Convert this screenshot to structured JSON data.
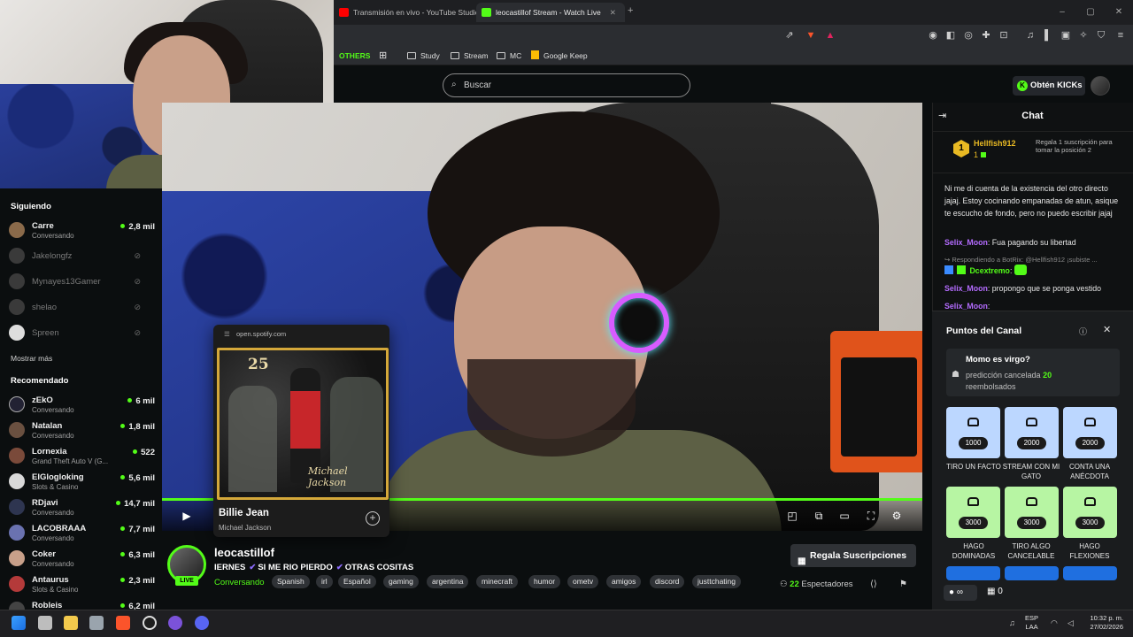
{
  "browser": {
    "tabs": [
      {
        "label": "Transmisión en vivo - YouTube Studio",
        "active": false
      },
      {
        "label": "leocastillof Stream - Watch Live",
        "active": true
      }
    ],
    "new_tab": "+",
    "bookmarks": {
      "others": "OTHERS",
      "items": [
        "Study",
        "Stream",
        "MC",
        "Google Keep"
      ]
    }
  },
  "header": {
    "search_placeholder": "Buscar",
    "kicks_button": "Obtén KICKs"
  },
  "sidebar": {
    "following_title": "Siguiendo",
    "following": [
      {
        "name": "Carre",
        "category": "Conversando",
        "viewers": "2,8 mil",
        "online": true
      },
      {
        "name": "Jakelongfz",
        "online": false
      },
      {
        "name": "Mynayes13Gamer",
        "online": false
      },
      {
        "name": "shelao",
        "online": false
      },
      {
        "name": "Spreen",
        "online": false
      }
    ],
    "show_more": "Mostrar más",
    "recommended_title": "Recomendado",
    "recommended": [
      {
        "name": "zEkO",
        "category": "Conversando",
        "viewers": "6 mil"
      },
      {
        "name": "Natalan",
        "category": "Conversando",
        "viewers": "1,8 mil"
      },
      {
        "name": "Lornexia",
        "category": "Grand Theft Auto V (G...",
        "viewers": "522"
      },
      {
        "name": "ElGlogloking",
        "category": "Slots & Casino",
        "viewers": "5,6 mil"
      },
      {
        "name": "RDjavi",
        "category": "Conversando",
        "viewers": "14,7 mil"
      },
      {
        "name": "LACOBRAAA",
        "category": "Conversando",
        "viewers": "7,7 mil"
      },
      {
        "name": "Coker",
        "category": "Conversando",
        "viewers": "6,3 mil"
      },
      {
        "name": "Antaurus",
        "category": "Slots & Casino",
        "viewers": "2,3 mil"
      },
      {
        "name": "Robleis",
        "category": "",
        "viewers": "6,2 mil"
      }
    ]
  },
  "spotify": {
    "url": "open.spotify.com",
    "album_number": "25",
    "album_signature": "Michael Jackson",
    "song": "Billie Jean",
    "artist": "Michael Jackson"
  },
  "channel": {
    "name": "leocastillof",
    "live_badge": "LIVE",
    "title_parts": [
      "IERNES",
      "SI ME RIO PIERDO",
      "OTRAS COSITAS"
    ],
    "category": "Conversando",
    "tags": [
      "Spanish",
      "irl",
      "Español",
      "gaming",
      "argentina",
      "minecraft",
      "humor",
      "ometv",
      "amigos",
      "discord",
      "justtchating"
    ],
    "gift_subs_button": "Regala Suscripciones",
    "viewers_count": "22",
    "viewers_label": "Espectadores"
  },
  "chat": {
    "title": "Chat",
    "pinned": {
      "badge": "1",
      "user": "Hellfish912",
      "count": "1",
      "gift_text": "Regala 1 suscripción para tomar la posición 2"
    },
    "messages": [
      {
        "user": "",
        "text": "Ni me di cuenta de la existencia del otro directo jajaj. Estoy cocinando empanadas de atun, asique te escucho de fondo, pero no puedo escribir jajaj",
        "color": "#e6e6e6"
      },
      {
        "user": "Selix_Moon",
        "text": "Fua pagando su libertad",
        "color": "#b46cff"
      },
      {
        "reply": "Respondiendo a BotRix: @Hellfish912 ¡subiste ..."
      },
      {
        "user": "Dcextremo",
        "text": "",
        "color": "#53fc18"
      },
      {
        "user": "Selix_Moon",
        "text": "propongo que se ponga vestido",
        "color": "#b46cff"
      },
      {
        "user": "Selix_Moon",
        "text": "",
        "color": "#b46cff"
      }
    ]
  },
  "points": {
    "title": "Puntos del Canal",
    "prediction": {
      "title": "Momo es virgo?",
      "status": "predicción cancelada",
      "refund_amount": "20",
      "refund_label": "reembolsados"
    },
    "rewards": [
      {
        "label": "TIRO UN FACTO",
        "cost": "1000",
        "color": "blue"
      },
      {
        "label": "STREAM CON MI GATO",
        "cost": "2000",
        "color": "blue"
      },
      {
        "label": "CONTA UNA ANÉCDOTA",
        "cost": "2000",
        "color": "blue"
      },
      {
        "label": "HAGO DOMINADAS",
        "cost": "3000",
        "color": "green"
      },
      {
        "label": "TIRO ALGO CANCELABLE",
        "cost": "3000",
        "color": "green"
      },
      {
        "label": "HAGO FLEXIONES",
        "cost": "3000",
        "color": "green"
      }
    ],
    "footer_points": "∞",
    "footer_gifts": "0"
  },
  "taskbar": {
    "lang_top": "ESP",
    "lang_bottom": "LAA",
    "time": "10:32 p. m.",
    "date": "27/02/2026"
  }
}
